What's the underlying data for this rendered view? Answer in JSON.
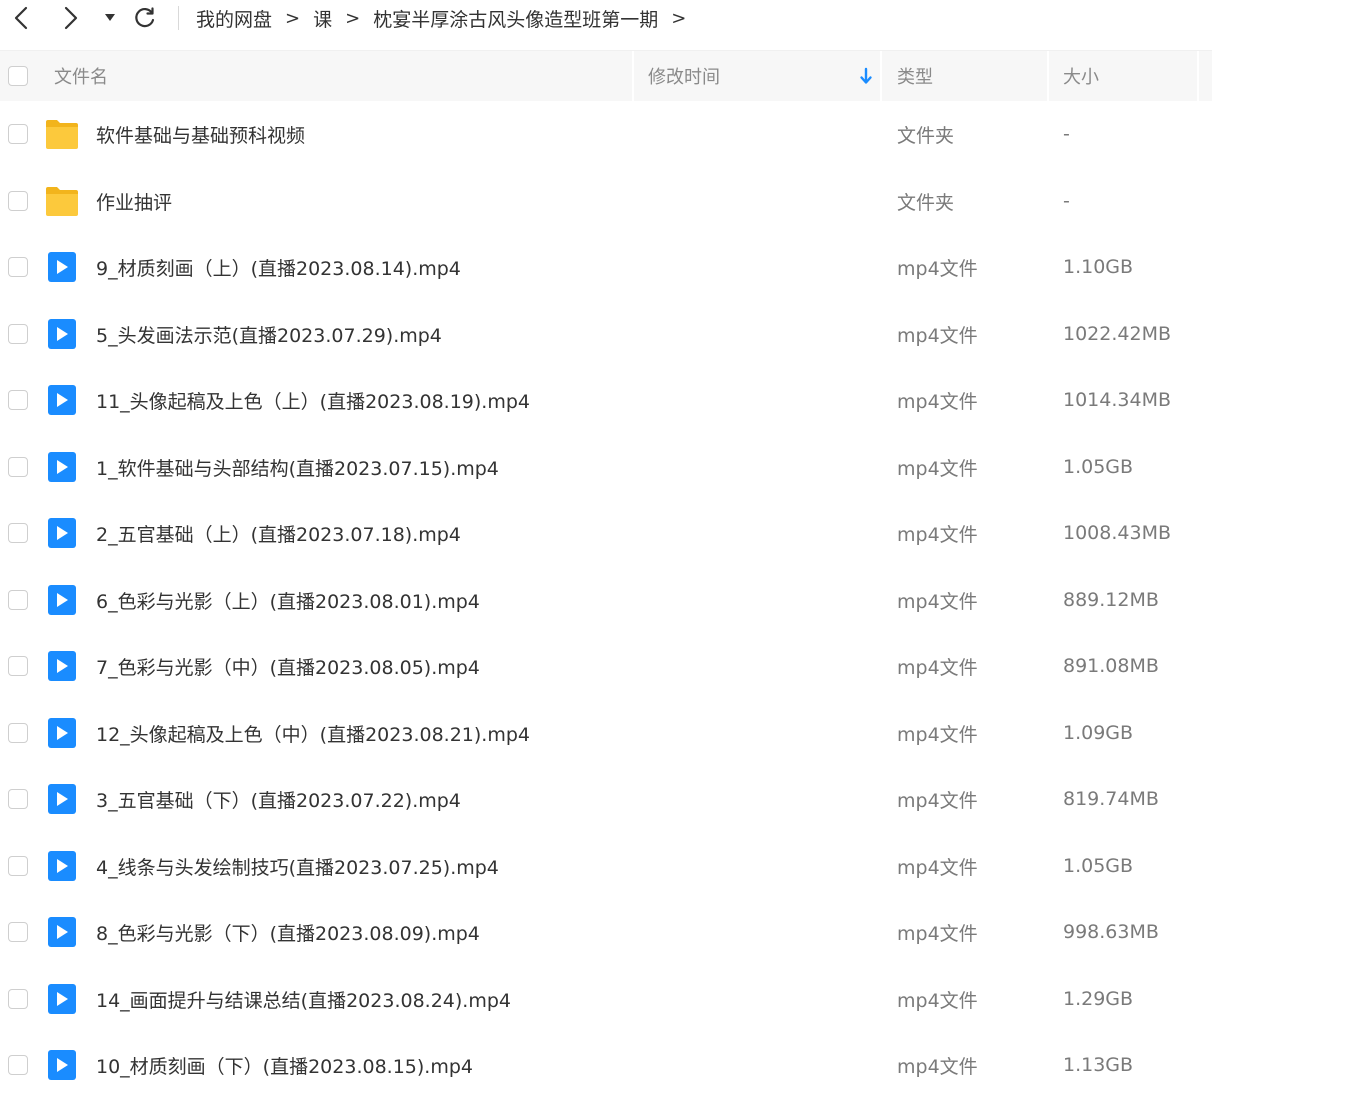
{
  "toolbar": {
    "back_icon": "chevron-left-icon",
    "forward_icon": "chevron-right-icon",
    "history_icon": "caret-down-icon",
    "refresh_icon": "refresh-icon"
  },
  "breadcrumb": {
    "items": [
      "我的网盘",
      "课",
      "枕宴半厚涂古风头像造型班第一期"
    ],
    "separator": ">"
  },
  "table": {
    "headers": {
      "name": "文件名",
      "modified": "修改时间",
      "type": "类型",
      "size": "大小"
    },
    "sort_indicator": "arrow-down-icon",
    "rows": [
      {
        "name": "软件基础与基础预科视频",
        "type": "文件夹",
        "size": "-",
        "icon": "folder-icon"
      },
      {
        "name": "作业抽评",
        "type": "文件夹",
        "size": "-",
        "icon": "folder-icon"
      },
      {
        "name": "9_材质刻画（上）(直播2023.08.14).mp4",
        "type": "mp4文件",
        "size": "1.10GB",
        "icon": "video-file-icon"
      },
      {
        "name": "5_头发画法示范(直播2023.07.29).mp4",
        "type": "mp4文件",
        "size": "1022.42MB",
        "icon": "video-file-icon"
      },
      {
        "name": "11_头像起稿及上色（上）(直播2023.08.19).mp4",
        "type": "mp4文件",
        "size": "1014.34MB",
        "icon": "video-file-icon"
      },
      {
        "name": "1_软件基础与头部结构(直播2023.07.15).mp4",
        "type": "mp4文件",
        "size": "1.05GB",
        "icon": "video-file-icon"
      },
      {
        "name": "2_五官基础（上）(直播2023.07.18).mp4",
        "type": "mp4文件",
        "size": "1008.43MB",
        "icon": "video-file-icon"
      },
      {
        "name": "6_色彩与光影（上）(直播2023.08.01).mp4",
        "type": "mp4文件",
        "size": "889.12MB",
        "icon": "video-file-icon"
      },
      {
        "name": "7_色彩与光影（中）(直播2023.08.05).mp4",
        "type": "mp4文件",
        "size": "891.08MB",
        "icon": "video-file-icon"
      },
      {
        "name": "12_头像起稿及上色（中）(直播2023.08.21).mp4",
        "type": "mp4文件",
        "size": "1.09GB",
        "icon": "video-file-icon"
      },
      {
        "name": "3_五官基础（下）(直播2023.07.22).mp4",
        "type": "mp4文件",
        "size": "819.74MB",
        "icon": "video-file-icon"
      },
      {
        "name": "4_线条与头发绘制技巧(直播2023.07.25).mp4",
        "type": "mp4文件",
        "size": "1.05GB",
        "icon": "video-file-icon"
      },
      {
        "name": "8_色彩与光影（下）(直播2023.08.09).mp4",
        "type": "mp4文件",
        "size": "998.63MB",
        "icon": "video-file-icon"
      },
      {
        "name": "14_画面提升与结课总结(直播2023.08.24).mp4",
        "type": "mp4文件",
        "size": "1.29GB",
        "icon": "video-file-icon"
      },
      {
        "name": "10_材质刻画（下）(直播2023.08.15).mp4",
        "type": "mp4文件",
        "size": "1.13GB",
        "icon": "video-file-icon"
      }
    ]
  },
  "colors": {
    "accent": "#1a8cff",
    "folder": "#fcc93c",
    "header_bg": "#f7f7f7"
  }
}
